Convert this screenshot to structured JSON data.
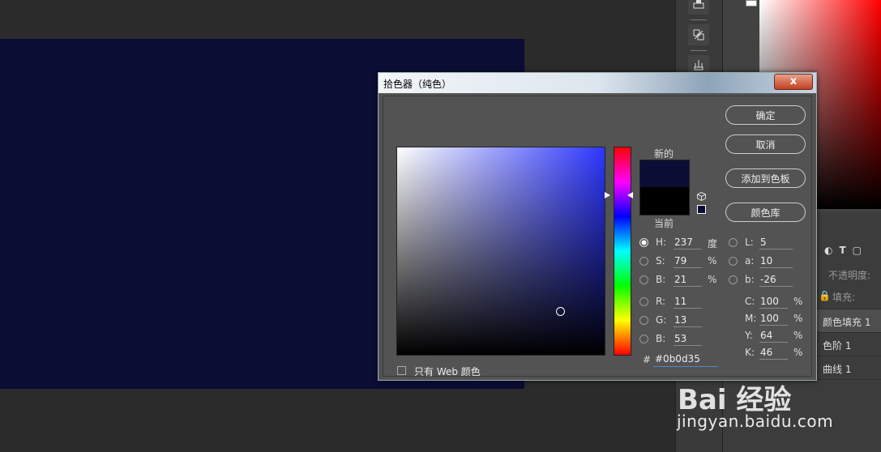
{
  "dialog": {
    "title": "拾色器（纯色）",
    "close_glyph": "x",
    "label_new": "新的",
    "label_current": "当前",
    "buttons": {
      "ok": "确定",
      "cancel": "取消",
      "add_to_swatches": "添加到色板",
      "color_libraries": "颜色库"
    },
    "only_web_colors": "只有 Web 颜色",
    "selected_model": "H",
    "fields": {
      "H": {
        "label": "H:",
        "value": "237",
        "unit": "度"
      },
      "S": {
        "label": "S:",
        "value": "79",
        "unit": "%"
      },
      "B": {
        "label": "B:",
        "value": "21",
        "unit": "%"
      },
      "R": {
        "label": "R:",
        "value": "11"
      },
      "G": {
        "label": "G:",
        "value": "13"
      },
      "Bb": {
        "label": "B:",
        "value": "53"
      },
      "L": {
        "label": "L:",
        "value": "5"
      },
      "a": {
        "label": "a:",
        "value": "10"
      },
      "b": {
        "label": "b:",
        "value": "-26"
      },
      "C": {
        "label": "C:",
        "value": "100",
        "unit": "%"
      },
      "M": {
        "label": "M:",
        "value": "100",
        "unit": "%"
      },
      "Y": {
        "label": "Y:",
        "value": "64",
        "unit": "%"
      },
      "K": {
        "label": "K:",
        "value": "46",
        "unit": "%"
      }
    },
    "hex_label": "#",
    "hex_value": "#0b0d35",
    "new_color": "#0b0d35",
    "current_color": "#000000"
  },
  "layers": {
    "opacity_label": "不透明度:",
    "fill_label": "填充:",
    "items": [
      {
        "name": "颜色填充 1"
      },
      {
        "name": "色阶 1"
      },
      {
        "name": "曲线 1"
      }
    ]
  },
  "watermark": {
    "text": "jingyan.baidu.com",
    "logo": "Bai 经验"
  },
  "colors": {
    "document": "#0b0d35",
    "workspace": "#2b2b2b",
    "dialog_bg": "#535353"
  }
}
